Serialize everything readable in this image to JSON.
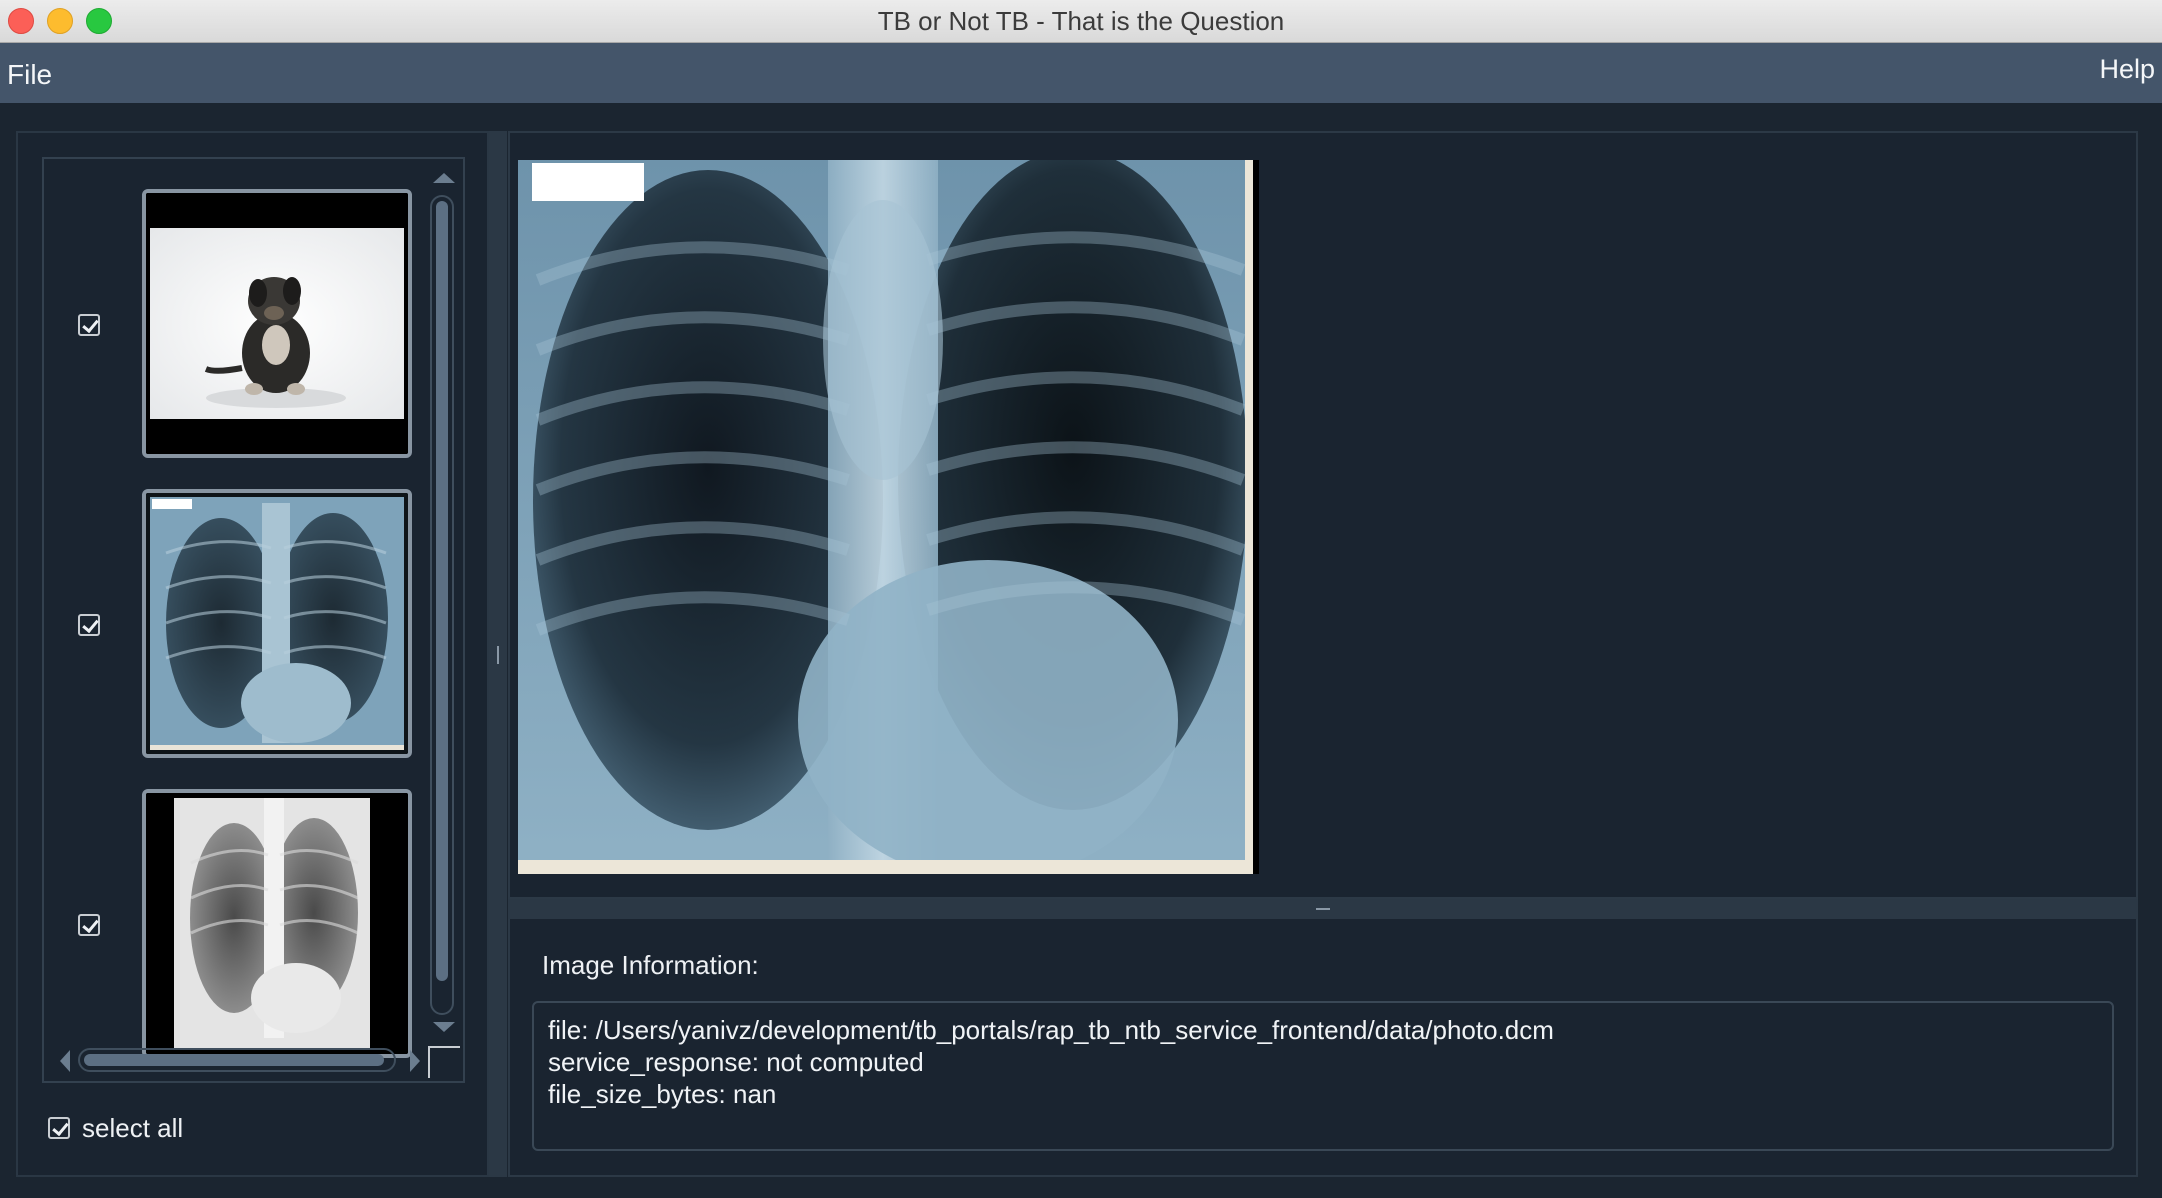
{
  "window": {
    "title": "TB or Not TB - That is the Question"
  },
  "menu": {
    "file": "File",
    "help": "Help"
  },
  "thumbnails": [
    {
      "kind": "photo-dog",
      "checked": true
    },
    {
      "kind": "xray-blue",
      "checked": true
    },
    {
      "kind": "xray-grayscale",
      "checked": true
    }
  ],
  "select_all": {
    "label": "select all",
    "checked": true
  },
  "info": {
    "title": "Image Information:",
    "lines": [
      "file: /Users/yanivz/development/tb_portals/rap_tb_ntb_service_frontend/data/photo.dcm",
      "service_response: not computed",
      "file_size_bytes: nan"
    ]
  },
  "colors": {
    "background": "#1b2530",
    "menubar": "#44556a",
    "xray_tint": "#7aa3c0"
  }
}
